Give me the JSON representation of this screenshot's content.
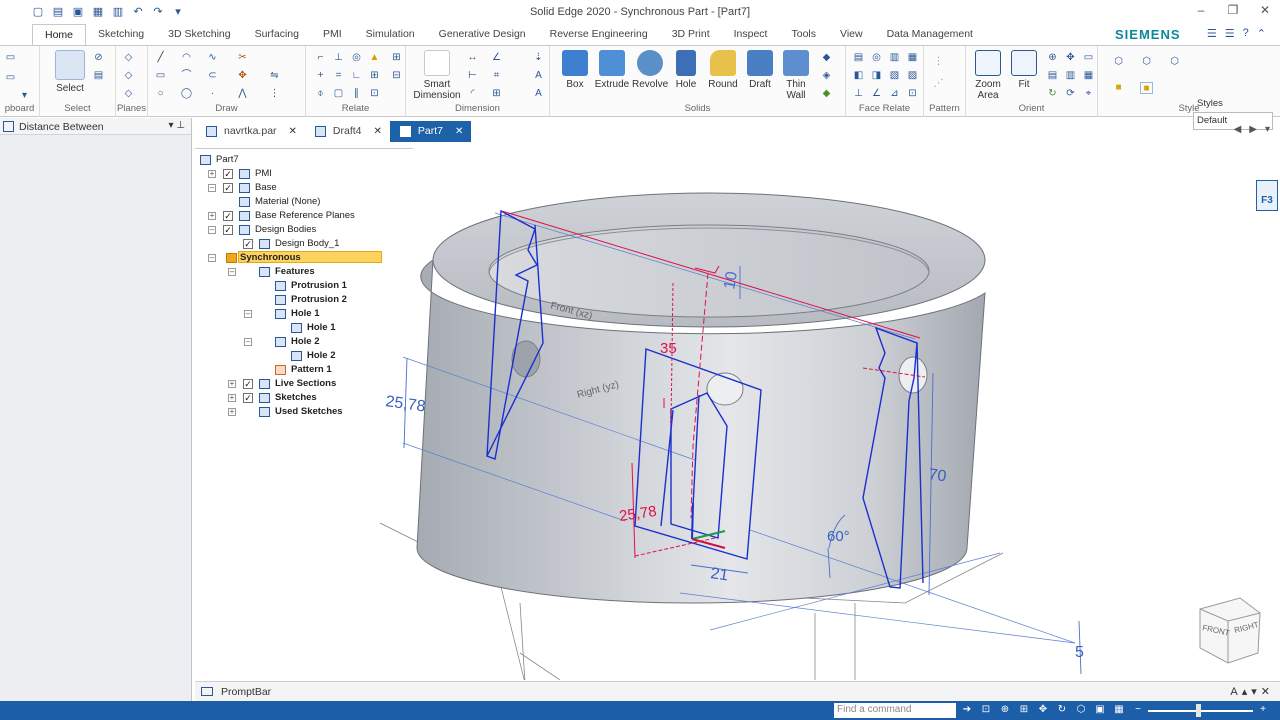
{
  "window": {
    "title": "Solid Edge 2020 - Synchronous Part - [Part7]"
  },
  "ribbon_tabs": [
    "Home",
    "Sketching",
    "3D Sketching",
    "Surfacing",
    "PMI",
    "Simulation",
    "Generative Design",
    "Reverse Engineering",
    "3D Print",
    "Inspect",
    "Tools",
    "View",
    "Data Management"
  ],
  "brand": "SIEMENS",
  "groups": {
    "clipboard": "pboard",
    "select": "Select",
    "planes": "Planes",
    "draw": "Draw",
    "relate": "Relate",
    "dimension": "Dimension",
    "solids": "Solids",
    "face_relate": "Face Relate",
    "pattern": "Pattern",
    "orient": "Orient",
    "style": "Style"
  },
  "buttons": {
    "select": "Select",
    "smart_dimension": [
      "Smart",
      "Dimension"
    ],
    "box": "Box",
    "extrude": "Extrude",
    "revolve": "Revolve",
    "hole": "Hole",
    "round": "Round",
    "draft": "Draft",
    "thin_wall": [
      "Thin",
      "Wall"
    ],
    "zoom_area": [
      "Zoom",
      "Area"
    ],
    "fit": "Fit"
  },
  "styles": {
    "label": "Styles",
    "value": "Default"
  },
  "pathfinder": {
    "title": "Distance Between"
  },
  "doc_tabs": [
    {
      "label": "navrtka.par",
      "active": false
    },
    {
      "label": "Draft4",
      "active": false
    },
    {
      "label": "Part7",
      "active": true
    }
  ],
  "tree": [
    {
      "label": "Part7"
    },
    {
      "label": "PMI"
    },
    {
      "label": "Base"
    },
    {
      "label": "Material (None)"
    },
    {
      "label": "Base Reference Planes"
    },
    {
      "label": "Design Bodies"
    },
    {
      "label": "Design Body_1"
    },
    {
      "label": "Synchronous"
    },
    {
      "label": "Features"
    },
    {
      "label": "Protrusion 1"
    },
    {
      "label": "Protrusion 2"
    },
    {
      "label": "Hole 1"
    },
    {
      "label": "Hole 1"
    },
    {
      "label": "Hole 2"
    },
    {
      "label": "Hole 2"
    },
    {
      "label": "Pattern 1"
    },
    {
      "label": "Live Sections"
    },
    {
      "label": "Sketches"
    },
    {
      "label": "Used Sketches"
    }
  ],
  "model": {
    "plane_front": "Front (xz)",
    "plane_right": "Right (yz)",
    "dims": {
      "d10": "10",
      "d35": "35",
      "d25_78_left": "25,78",
      "d25_78_mid": "25,78",
      "d21": "21",
      "d60": "60°",
      "d70": "70",
      "d5": "5"
    },
    "cube": {
      "front": "FRONT",
      "right": "RIGHT"
    }
  },
  "f3": "F3",
  "promptbar": {
    "label": "PromptBar"
  },
  "status": {
    "command_placeholder": "Find a command"
  },
  "colors": {
    "accent": "#1d61a8",
    "dim_red": "#e0104a",
    "sketch_blue": "#1a2fd0",
    "brand": "#0a8a9a"
  }
}
